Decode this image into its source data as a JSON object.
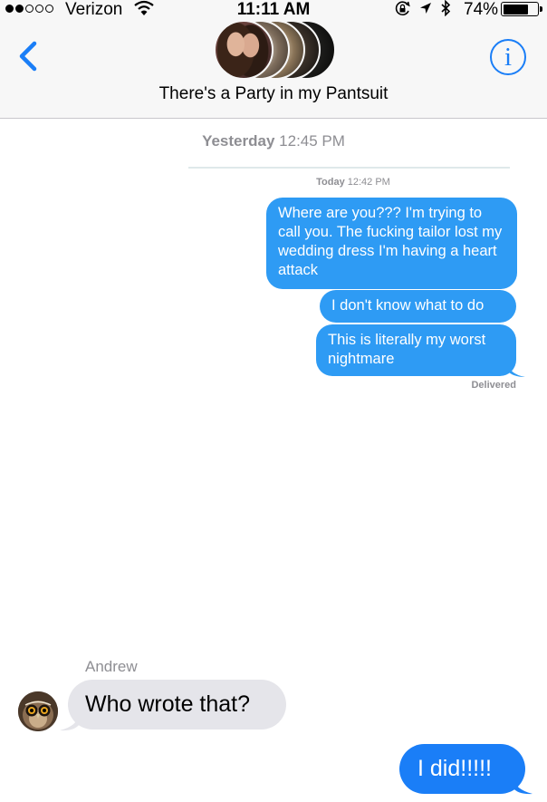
{
  "status_bar": {
    "carrier": "Verizon",
    "time": "11:11 AM",
    "battery_percent": "74%",
    "battery_level": 0.74,
    "signal_bars_filled": 2,
    "signal_bars_total": 5
  },
  "header": {
    "group_title": "There's a Party in my Pantsuit",
    "info_label": "i",
    "participant_count": 5
  },
  "thread": {
    "yesterday_day": "Yesterday",
    "yesterday_time": "12:45 PM",
    "embedded": {
      "today_day": "Today",
      "today_time": "12:42 PM",
      "messages": [
        "Where are you??? I'm trying to call you. The fucking tailor lost my wedding dress I'm having a heart attack",
        "I don't know what to do",
        "This is literally my worst nightmare"
      ],
      "status": "Delivered"
    },
    "incoming": {
      "sender": "Andrew",
      "text": "Who wrote that?"
    },
    "outgoing": {
      "text": "I did!!!!!"
    }
  },
  "colors": {
    "ios_blue": "#1a7ef7",
    "embedded_bubble_blue": "#2e9bf4",
    "received_bubble_gray": "#e5e5ea",
    "meta_gray": "#8e8e93"
  }
}
